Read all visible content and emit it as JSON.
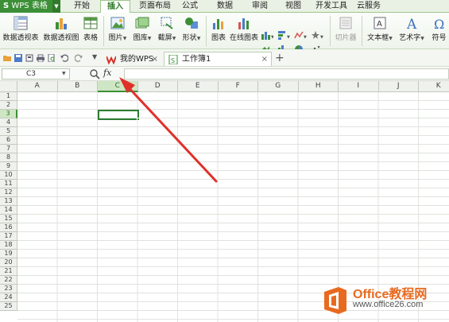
{
  "app": {
    "menu_label": "WPS 表格",
    "menu_logo": "S"
  },
  "menu_tabs": [
    {
      "label": "开始"
    },
    {
      "label": "插入",
      "active": true
    },
    {
      "label": "页面布局"
    },
    {
      "label": "公式"
    },
    {
      "label": "数据"
    },
    {
      "label": "审阅"
    },
    {
      "label": "视图"
    },
    {
      "label": "开发工具"
    },
    {
      "label": "云服务"
    }
  ],
  "ribbon": {
    "pivot_table": "数据透视表",
    "pivot_chart": "数据透视图",
    "table": "表格",
    "picture": "图片",
    "gallery": "图库",
    "screenshot": "截屏",
    "shapes": "形状",
    "chart": "图表",
    "online_chart": "在线图表",
    "slicer": "切片器",
    "textbox": "文本框",
    "wordart": "艺术字",
    "symbol": "符号"
  },
  "doc_tabs": [
    {
      "label": "我的WPS",
      "close": "×"
    },
    {
      "label": "工作簿1",
      "close": "×",
      "active": true
    }
  ],
  "doc_tabs_add": "+",
  "formula_bar": {
    "cell_ref": "C3",
    "fx": "fx",
    "value": ""
  },
  "sheet": {
    "columns": [
      "A",
      "B",
      "C",
      "D",
      "E",
      "F",
      "G",
      "H",
      "I",
      "J",
      "K"
    ],
    "rows": [
      "1",
      "2",
      "3",
      "4",
      "5",
      "6",
      "7",
      "8",
      "9",
      "10",
      "11",
      "12",
      "13",
      "14",
      "15",
      "16",
      "17",
      "18",
      "19",
      "20",
      "21",
      "22",
      "23",
      "24",
      "25"
    ],
    "selected_column": "C",
    "selected_row": "3"
  },
  "watermark": {
    "title": "Office教程网",
    "url": "www.office26.com"
  },
  "colors": {
    "accent_green": "#3c8f36",
    "arrow_red": "#e0302a",
    "watermark_orange": "#e86a1f"
  }
}
